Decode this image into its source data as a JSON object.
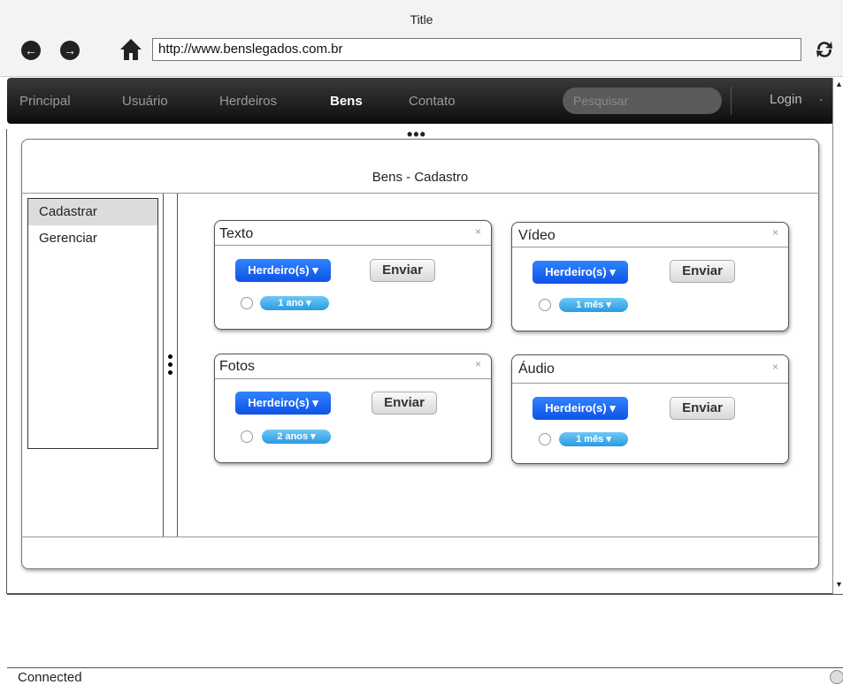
{
  "window": {
    "title": "Title"
  },
  "browser": {
    "back_icon": "back-arrow-icon",
    "forward_icon": "forward-arrow-icon",
    "home_icon": "home-icon",
    "url": "http://www.benslegados.com.br",
    "refresh_icon": "refresh-icon"
  },
  "navbar": {
    "items": [
      {
        "label": "Principal"
      },
      {
        "label": "Usuário"
      },
      {
        "label": "Herdeiros"
      },
      {
        "label": "Bens",
        "active": true
      },
      {
        "label": "Contato"
      }
    ],
    "search_placeholder": "Pesquisar",
    "login_label": "Login"
  },
  "panel": {
    "title": "Bens - Cadastro"
  },
  "sidebar": {
    "items": [
      {
        "label": "Cadastrar",
        "selected": true
      },
      {
        "label": "Gerenciar"
      }
    ]
  },
  "cards": [
    {
      "title": "Texto",
      "dropdown": "Herdeiro(s) ▾",
      "button": "Enviar",
      "period": "1 ano ▾"
    },
    {
      "title": "Vídeo",
      "dropdown": "Herdeiro(s) ▾",
      "button": "Enviar",
      "period": "1 mês ▾"
    },
    {
      "title": "Fotos",
      "dropdown": "Herdeiro(s) ▾",
      "button": "Enviar",
      "period": "2 anos ▾"
    },
    {
      "title": "Áudio",
      "dropdown": "Herdeiro(s) ▾",
      "button": "Enviar",
      "period": "1 mês ▾"
    }
  ],
  "status": {
    "text": "Connected"
  },
  "colors": {
    "dropdown": "#1a5ef5",
    "pill": "#3aa8e8",
    "navbar": "#1a1a1a"
  }
}
